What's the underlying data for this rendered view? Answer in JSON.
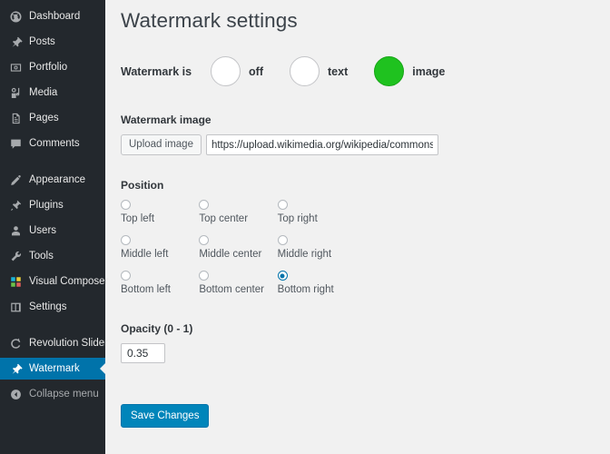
{
  "sidebar": {
    "items": [
      {
        "label": "Dashboard",
        "icon": "dashboard-icon",
        "state": "normal"
      },
      {
        "label": "Posts",
        "icon": "pin-icon",
        "state": "normal"
      },
      {
        "label": "Portfolio",
        "icon": "portfolio-icon",
        "state": "normal"
      },
      {
        "label": "Media",
        "icon": "media-icon",
        "state": "normal"
      },
      {
        "label": "Pages",
        "icon": "pages-icon",
        "state": "normal"
      },
      {
        "label": "Comments",
        "icon": "comments-icon",
        "state": "normal"
      },
      {
        "label": "Appearance",
        "icon": "brush-icon",
        "state": "normal"
      },
      {
        "label": "Plugins",
        "icon": "plugins-icon",
        "state": "normal"
      },
      {
        "label": "Users",
        "icon": "users-icon",
        "state": "normal"
      },
      {
        "label": "Tools",
        "icon": "tools-icon",
        "state": "normal"
      },
      {
        "label": "Visual Composer",
        "icon": "visual-composer-icon",
        "state": "normal"
      },
      {
        "label": "Settings",
        "icon": "settings-icon",
        "state": "normal"
      },
      {
        "label": "Revolution Slider",
        "icon": "revolution-slider-icon",
        "state": "normal"
      },
      {
        "label": "Watermark",
        "icon": "pin-icon",
        "state": "active"
      },
      {
        "label": "Collapse menu",
        "icon": "collapse-icon",
        "state": "dim"
      }
    ],
    "active_color": "#0073aa",
    "background": "#23282d"
  },
  "main": {
    "title": "Watermark settings",
    "watermark_is": {
      "label": "Watermark is",
      "options": [
        {
          "label": "off",
          "selected": false
        },
        {
          "label": "text",
          "selected": false
        },
        {
          "label": "image",
          "selected": true
        }
      ],
      "selected_color": "#1fc21f"
    },
    "watermark_image": {
      "label": "Watermark image",
      "upload_button": "Upload image",
      "url_value": "https://upload.wikimedia.org/wikipedia/commons/thumb/",
      "url_placeholder": ""
    },
    "position": {
      "label": "Position",
      "rows": [
        [
          {
            "label": "Top left",
            "selected": false
          },
          {
            "label": "Top center",
            "selected": false
          },
          {
            "label": "Top right",
            "selected": false
          }
        ],
        [
          {
            "label": "Middle left",
            "selected": false
          },
          {
            "label": "Middle center",
            "selected": false
          },
          {
            "label": "Middle right",
            "selected": false
          }
        ],
        [
          {
            "label": "Bottom left",
            "selected": false
          },
          {
            "label": "Bottom center",
            "selected": false
          },
          {
            "label": "Bottom right",
            "selected": true
          }
        ]
      ],
      "selected_value": "Bottom right"
    },
    "opacity": {
      "label": "Opacity (0 - 1)",
      "value": "0.35"
    },
    "save_button": "Save Changes",
    "save_button_color": "#0085ba"
  }
}
